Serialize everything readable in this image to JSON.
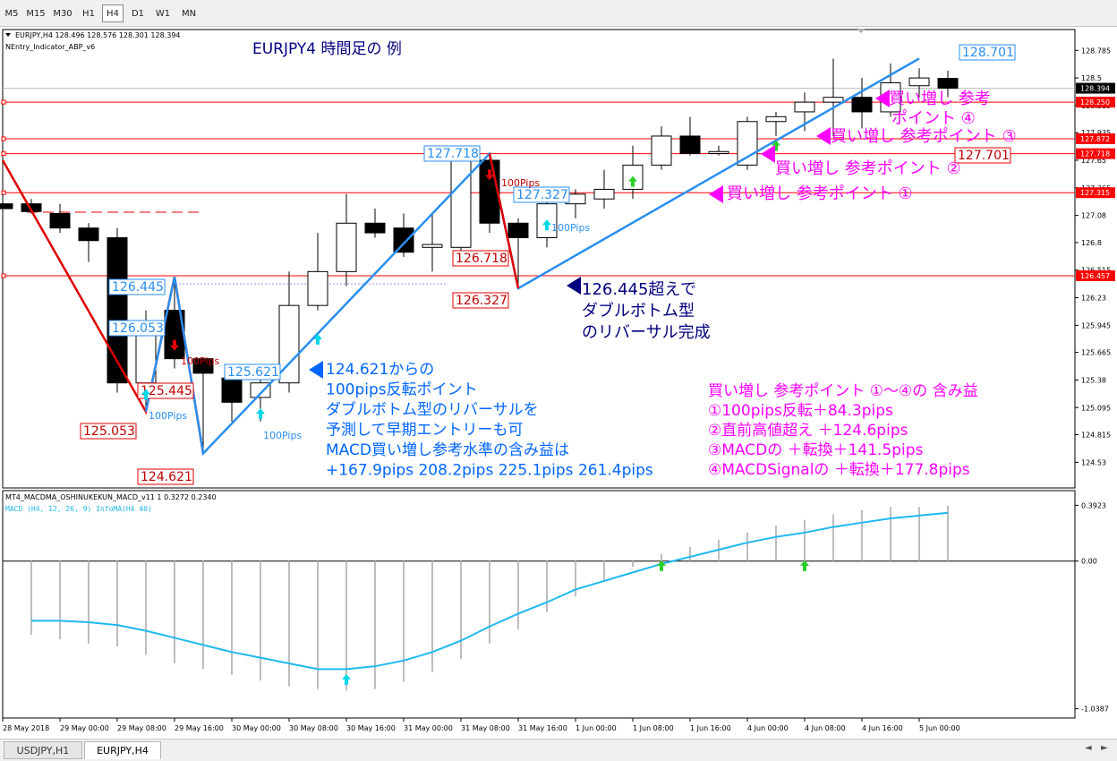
{
  "toolbar": {
    "timeframes": [
      {
        "label": "M5",
        "active": false
      },
      {
        "label": "M15",
        "active": false
      },
      {
        "label": "M30",
        "active": false
      },
      {
        "label": "H1",
        "active": false
      },
      {
        "label": "H4",
        "active": true
      },
      {
        "label": "D1",
        "active": false
      },
      {
        "label": "W1",
        "active": false
      },
      {
        "label": "MN",
        "active": false
      }
    ]
  },
  "chart_header": {
    "symbol_line": "EURJPY,H4  128.496 128.576 128.301 128.394",
    "indicator_name": "NEntry_Indicator_ABP_v6",
    "title": "EURJPY4 時間足の 例"
  },
  "chart_data": [
    {
      "type": "candlestick",
      "symbol": "EURJPY",
      "timeframe": "H4",
      "ohlc_last": {
        "open": 128.496,
        "high": 128.576,
        "low": 128.301,
        "close": 128.394
      },
      "y_ticks": [
        128.785,
        128.5,
        128.215,
        127.935,
        127.65,
        127.365,
        127.08,
        126.8,
        126.515,
        126.23,
        125.945,
        125.665,
        125.38,
        125.095,
        124.815,
        124.53
      ],
      "ylim": [
        124.45,
        128.88
      ],
      "x_tick_labels": [
        "28 May 2018",
        "29 May 00:00",
        "29 May 08:00",
        "29 May 16:00",
        "30 May 00:00",
        "30 May 08:00",
        "30 May 16:00",
        "31 May 00:00",
        "31 May 08:00",
        "31 May 16:00",
        "1 Jun 00:00",
        "1 Jun 08:00",
        "1 Jun 16:00",
        "4 Jun 00:00",
        "4 Jun 08:00",
        "4 Jun 16:00",
        "5 Jun 00:00"
      ],
      "candles": [
        {
          "o": 127.2,
          "h": 127.3,
          "l": 126.9,
          "c": 127.15
        },
        {
          "o": 127.2,
          "h": 127.25,
          "l": 127.1,
          "c": 127.12
        },
        {
          "o": 127.1,
          "h": 127.2,
          "l": 126.9,
          "c": 126.95
        },
        {
          "o": 126.95,
          "h": 127.0,
          "l": 126.6,
          "c": 126.82
        },
        {
          "o": 126.85,
          "h": 126.95,
          "l": 125.25,
          "c": 125.35
        },
        {
          "o": 125.35,
          "h": 126.1,
          "l": 125.053,
          "c": 125.95
        },
        {
          "o": 126.1,
          "h": 126.445,
          "l": 125.5,
          "c": 125.6
        },
        {
          "o": 125.6,
          "h": 125.6,
          "l": 124.621,
          "c": 125.45
        },
        {
          "o": 125.4,
          "h": 125.45,
          "l": 124.95,
          "c": 125.15
        },
        {
          "o": 125.2,
          "h": 125.45,
          "l": 124.95,
          "c": 125.35
        },
        {
          "o": 125.35,
          "h": 126.5,
          "l": 125.25,
          "c": 126.15
        },
        {
          "o": 126.15,
          "h": 126.9,
          "l": 126.1,
          "c": 126.5
        },
        {
          "o": 126.5,
          "h": 127.3,
          "l": 126.35,
          "c": 127.0
        },
        {
          "o": 127.0,
          "h": 127.15,
          "l": 126.85,
          "c": 126.9
        },
        {
          "o": 126.95,
          "h": 127.1,
          "l": 126.65,
          "c": 126.7
        },
        {
          "o": 126.75,
          "h": 127.1,
          "l": 126.5,
          "c": 126.78
        },
        {
          "o": 126.75,
          "h": 127.718,
          "l": 126.65,
          "c": 127.65
        },
        {
          "o": 127.65,
          "h": 127.718,
          "l": 126.9,
          "c": 127.0
        },
        {
          "o": 127.0,
          "h": 127.05,
          "l": 126.327,
          "c": 126.85
        },
        {
          "o": 126.85,
          "h": 127.35,
          "l": 126.75,
          "c": 127.2
        },
        {
          "o": 127.2,
          "h": 127.35,
          "l": 127.05,
          "c": 127.3
        },
        {
          "o": 127.25,
          "h": 127.55,
          "l": 127.15,
          "c": 127.35
        },
        {
          "o": 127.35,
          "h": 127.8,
          "l": 127.25,
          "c": 127.6
        },
        {
          "o": 127.6,
          "h": 128.0,
          "l": 127.55,
          "c": 127.9
        },
        {
          "o": 127.9,
          "h": 128.1,
          "l": 127.7,
          "c": 127.72
        },
        {
          "o": 127.72,
          "h": 127.8,
          "l": 127.7,
          "c": 127.74
        },
        {
          "o": 127.6,
          "h": 128.1,
          "l": 127.55,
          "c": 128.05
        },
        {
          "o": 128.05,
          "h": 128.15,
          "l": 127.9,
          "c": 128.1
        },
        {
          "o": 128.15,
          "h": 128.35,
          "l": 127.95,
          "c": 128.25
        },
        {
          "o": 128.25,
          "h": 128.7,
          "l": 127.9,
          "c": 128.3
        },
        {
          "o": 128.3,
          "h": 128.5,
          "l": 127.98,
          "c": 128.15
        },
        {
          "o": 128.15,
          "h": 128.65,
          "l": 128.1,
          "c": 128.45
        },
        {
          "o": 128.42,
          "h": 128.6,
          "l": 128.3,
          "c": 128.5
        },
        {
          "o": 128.496,
          "h": 128.576,
          "l": 128.301,
          "c": 128.394
        }
      ],
      "horizontal_levels": [
        {
          "value": 128.25,
          "label": "128.250",
          "color": "#ff0000"
        },
        {
          "value": 127.872,
          "label": "127.872",
          "color": "#ff0000"
        },
        {
          "value": 127.718,
          "label": "127.718",
          "color": "#ff0000"
        },
        {
          "value": 127.315,
          "label": "127.315",
          "color": "#ff0000"
        },
        {
          "value": 126.457,
          "label": "126.457",
          "color": "#ff0000"
        }
      ],
      "current_price": {
        "value": 128.394,
        "label": "128.394"
      },
      "zigzag_down": [
        {
          "bar": 0,
          "price": 127.65
        },
        {
          "bar": 5,
          "price": 125.053
        },
        {
          "bar": 6,
          "price": 126.445
        },
        {
          "bar": 7,
          "price": 124.621
        }
      ],
      "zigzag_up": [
        {
          "bar": 5,
          "price": 125.053
        },
        {
          "bar": 6,
          "price": 126.445
        },
        {
          "bar": 7,
          "price": 124.621
        },
        {
          "bar": 17,
          "price": 127.718
        },
        {
          "bar": 18,
          "price": 126.327
        },
        {
          "bar": 32,
          "price": 128.701
        }
      ],
      "price_labels": [
        {
          "bar": 32,
          "price": 128.701,
          "text": "128.701",
          "color": "blue"
        },
        {
          "bar": 17,
          "price": 127.718,
          "text": "127.718",
          "color": "blue"
        },
        {
          "bar": 18,
          "price": 127.327,
          "text": "127.327",
          "color": "blue"
        },
        {
          "bar": 31,
          "price": 127.701,
          "text": "127.701",
          "color": "red"
        },
        {
          "bar": 17,
          "price": 126.718,
          "text": "126.718",
          "color": "red"
        },
        {
          "bar": 17,
          "price": 126.327,
          "text": "126.327",
          "color": "red"
        },
        {
          "bar": 5,
          "price": 126.445,
          "text": "126.445",
          "color": "blue"
        },
        {
          "bar": 5,
          "price": 126.053,
          "text": "126.053",
          "color": "blue"
        },
        {
          "bar": 8,
          "price": 125.621,
          "text": "125.621",
          "color": "blue"
        },
        {
          "bar": 5,
          "price": 125.445,
          "text": "125.445",
          "color": "red"
        },
        {
          "bar": 4,
          "price": 125.053,
          "text": "125.053",
          "color": "red"
        },
        {
          "bar": 6,
          "price": 124.621,
          "text": "124.621",
          "color": "red"
        }
      ],
      "pips_labels": [
        {
          "bar": 6,
          "price": 125.8,
          "text": "100Pips",
          "color": "red"
        },
        {
          "bar": 17,
          "price": 127.55,
          "text": "100Pips",
          "color": "red"
        },
        {
          "bar": 5,
          "price": 125.12,
          "text": "100Pips",
          "color": "blue"
        },
        {
          "bar": 9,
          "price": 124.97,
          "text": "100Pips",
          "color": "blue"
        },
        {
          "bar": 19,
          "price": 126.92,
          "text": "100Pips",
          "color": "blue"
        }
      ],
      "arrows": [
        {
          "bar": 6,
          "price": 125.72,
          "dir": "down",
          "color": "red"
        },
        {
          "bar": 17,
          "price": 127.48,
          "dir": "down",
          "color": "red"
        },
        {
          "bar": 5,
          "price": 125.25,
          "dir": "up",
          "color": "cyan"
        },
        {
          "bar": 9,
          "price": 125.05,
          "dir": "up",
          "color": "cyan"
        },
        {
          "bar": 11,
          "price": 125.82,
          "dir": "up",
          "color": "cyan"
        },
        {
          "bar": 19,
          "price": 127.0,
          "dir": "up",
          "color": "cyan"
        },
        {
          "bar": 22,
          "price": 127.45,
          "dir": "up",
          "color": "green"
        },
        {
          "bar": 27,
          "price": 127.82,
          "dir": "up",
          "color": "green"
        }
      ],
      "annotations": [
        {
          "id": "pt4",
          "lines": [
            "買い増し 参考",
            "ポイント ④"
          ],
          "color": "#ff00ff",
          "marker": "left-triangle"
        },
        {
          "id": "pt3",
          "lines": [
            "買い増し 参考ポイント ③"
          ],
          "color": "#ff00ff",
          "marker": "left-triangle"
        },
        {
          "id": "pt2",
          "lines": [
            "買い増し 参考ポイント ②"
          ],
          "color": "#ff00ff",
          "marker": "left-triangle"
        },
        {
          "id": "pt1",
          "lines": [
            "買い増し 参考ポイント ①"
          ],
          "color": "#ff00ff",
          "marker": "left-triangle"
        },
        {
          "id": "dbl",
          "lines": [
            "126.445超えで",
            "ダブルボトム型",
            "のリバーサル完成"
          ],
          "color": "#000080",
          "marker": "left-triangle"
        },
        {
          "id": "early",
          "lines": [
            "124.621からの",
            "100pips反転ポイント",
            "ダブルボトム型のリバーサルを",
            "予測して早期エントリーも可",
            "MACD買い増し参考水準の含み益は",
            "+167.9pips 208.2pips 225.1pips 261.4pips"
          ],
          "color": "#0066ff",
          "marker": "left-triangle"
        },
        {
          "id": "profit",
          "lines": [
            "買い増し 参考ポイント ①～④の 含み益",
            "①100pips反転＋84.3pips",
            "②直前高値超え ＋124.6pips",
            "③MACDの ＋転換＋141.5pips",
            "④MACDSignalの ＋転換＋177.8pips"
          ],
          "color": "#ff00ff",
          "marker": "none"
        }
      ],
      "colors": {
        "bull": "#ffffff",
        "bear": "#000000",
        "zigzag_down": "#e00000",
        "zigzag_up": "#2a8ef0",
        "level": "#ff0000"
      }
    },
    {
      "type": "histogram-line",
      "indicator_line1": "MT4_MACDMA_OSHINUKEKUN_MACD_v11 1 0.3272 0.2340",
      "indicator_line2": "MACD (H4, 12, 26, 9) InfoMA(H4 40)",
      "y_ticks": [
        0.3923,
        0.0,
        -1.0387
      ],
      "y_tick_labels": [
        "0.3923",
        "0.00",
        "-1.0387"
      ],
      "ylim": [
        -1.06,
        0.42
      ],
      "macd": [
        -0.52,
        -0.55,
        -0.58,
        -0.6,
        -0.66,
        -0.72,
        -0.76,
        -0.8,
        -0.84,
        -0.88,
        -0.9,
        -0.91,
        -0.9,
        -0.85,
        -0.78,
        -0.69,
        -0.58,
        -0.48,
        -0.36,
        -0.25,
        -0.14,
        -0.04,
        0.05,
        0.1,
        0.15,
        0.2,
        0.25,
        0.29,
        0.33,
        0.36,
        0.38,
        0.38,
        0.39
      ],
      "signal": [
        -0.42,
        -0.42,
        -0.43,
        -0.45,
        -0.49,
        -0.54,
        -0.59,
        -0.64,
        -0.68,
        -0.72,
        -0.76,
        -0.76,
        -0.74,
        -0.7,
        -0.64,
        -0.56,
        -0.46,
        -0.37,
        -0.29,
        -0.2,
        -0.14,
        -0.08,
        -0.02,
        0.03,
        0.08,
        0.13,
        0.17,
        0.2,
        0.24,
        0.27,
        0.3,
        0.32,
        0.34
      ],
      "arrows": [
        {
          "bar": 11,
          "value": -0.82,
          "color": "cyan"
        },
        {
          "bar": 22,
          "value": -0.02,
          "color": "green"
        },
        {
          "bar": 27,
          "value": -0.02,
          "color": "green"
        }
      ],
      "colors": {
        "histogram": "#bdbdbd",
        "signal": "#1fb8f0"
      }
    }
  ],
  "bottom_tabs": [
    {
      "label": "USDJPY,H1",
      "active": false
    },
    {
      "label": "EURJPY,H4",
      "active": true
    }
  ]
}
